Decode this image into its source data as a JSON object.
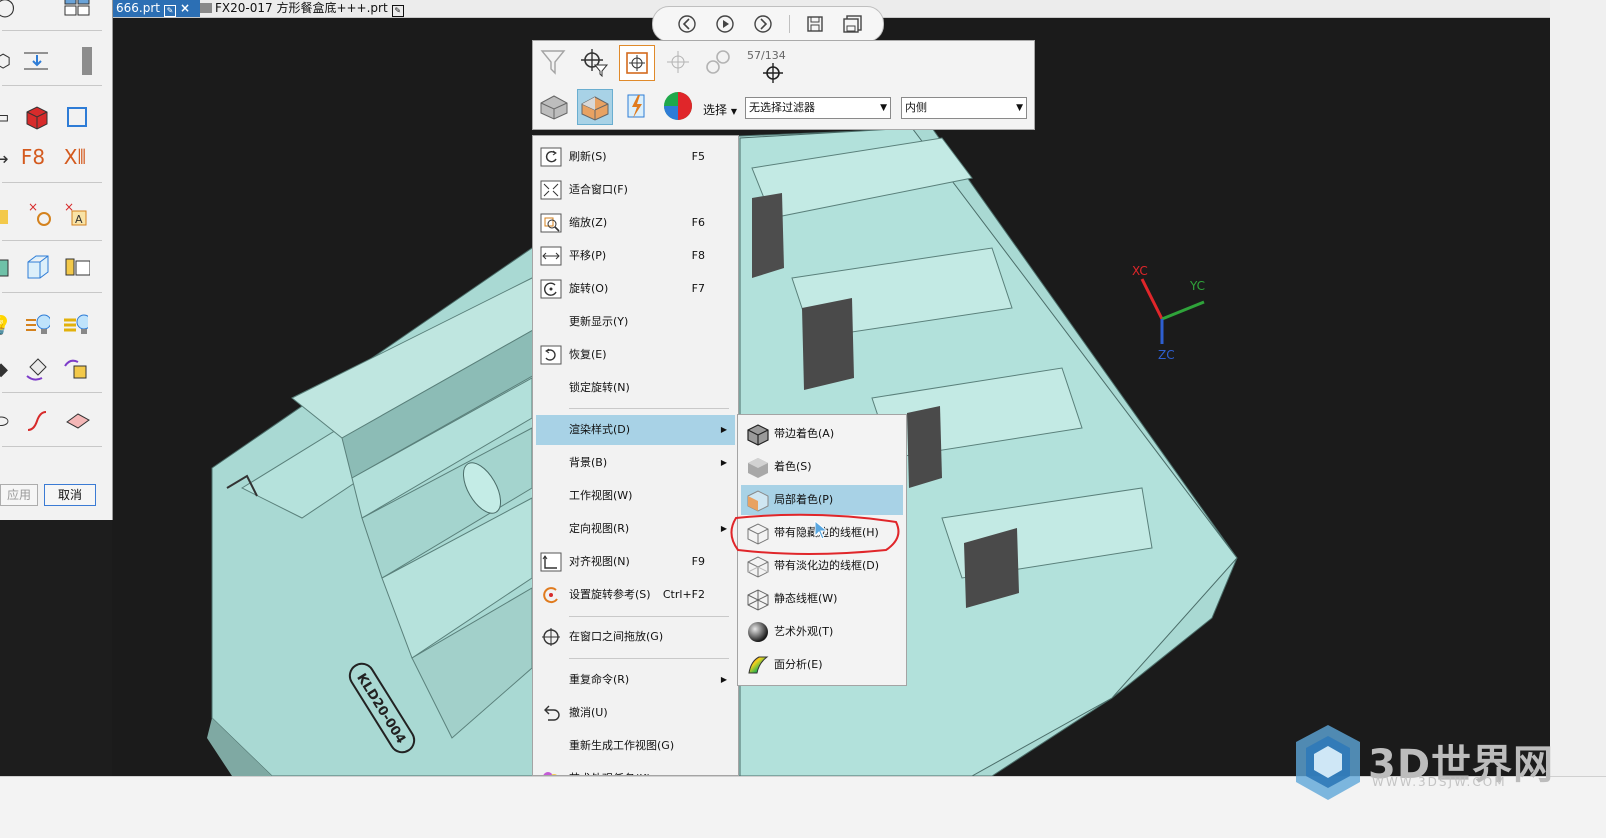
{
  "tabs": [
    {
      "label": "666.prt"
    },
    {
      "label": "FX20-017 方形餐盒底+++.prt"
    }
  ],
  "left_panel": {
    "f8_label": "F8",
    "apply_label": "应用",
    "cancel_label": "取消"
  },
  "selection_toolbar": {
    "counter": "57/134",
    "select_label": "选择",
    "filter_value": "无选择过滤器",
    "scope_value": "内侧"
  },
  "context_menu": {
    "items": [
      {
        "label": "刷新(S)",
        "shortcut": "F5",
        "icon": "refresh-icon"
      },
      {
        "label": "适合窗口(F)",
        "shortcut": "",
        "icon": "fit-window-icon"
      },
      {
        "label": "缩放(Z)",
        "shortcut": "F6",
        "icon": "zoom-icon"
      },
      {
        "label": "平移(P)",
        "shortcut": "F8",
        "icon": "pan-icon"
      },
      {
        "label": "旋转(O)",
        "shortcut": "F7",
        "icon": "rotate-icon"
      },
      {
        "label": "更新显示(Y)",
        "shortcut": "",
        "icon": ""
      },
      {
        "label": "恢复(E)",
        "shortcut": "",
        "icon": "restore-icon"
      },
      {
        "label": "锁定旋转(N)",
        "shortcut": "",
        "icon": ""
      },
      {
        "label": "渲染样式(D)",
        "shortcut": "",
        "icon": ""
      },
      {
        "label": "背景(B)",
        "shortcut": "",
        "icon": ""
      },
      {
        "label": "工作视图(W)",
        "shortcut": "",
        "icon": ""
      },
      {
        "label": "定向视图(R)",
        "shortcut": "",
        "icon": ""
      },
      {
        "label": "对齐视图(N)",
        "shortcut": "F9",
        "icon": "align-view-icon"
      },
      {
        "label": "设置旋转参考(S)",
        "shortcut": "Ctrl+F2",
        "icon": "rotate-reference-icon"
      },
      {
        "label": "在窗口之间拖放(G)",
        "shortcut": "",
        "icon": "drag-between-windows-icon"
      },
      {
        "label": "重复命令(R)",
        "shortcut": "",
        "icon": ""
      },
      {
        "label": "撤消(U)",
        "shortcut": "",
        "icon": "undo-icon"
      },
      {
        "label": "重新生成工作视图(G)",
        "shortcut": "",
        "icon": ""
      },
      {
        "label": "艺术外观任务(K)",
        "shortcut": "",
        "icon": "artistic-appearance-icon"
      }
    ],
    "highlighted": "渲染样式(D)"
  },
  "render_submenu": {
    "items": [
      {
        "label": "带边着色(A)",
        "icon": "shaded-with-edges-icon"
      },
      {
        "label": "着色(S)",
        "icon": "shaded-icon"
      },
      {
        "label": "局部着色(P)",
        "icon": "partial-shading-icon"
      },
      {
        "label": "带有隐藏边的线框(H)",
        "icon": "wireframe-hidden-edges-icon"
      },
      {
        "label": "带有淡化边的线框(D)",
        "icon": "wireframe-dim-edges-icon"
      },
      {
        "label": "静态线框(W)",
        "icon": "static-wireframe-icon"
      },
      {
        "label": "艺术外观(T)",
        "icon": "artistic-appearance-sphere-icon"
      },
      {
        "label": "面分析(E)",
        "icon": "face-analysis-icon"
      }
    ],
    "highlighted": "局部着色(P)",
    "annotated": "带有隐藏边的线框(H)"
  },
  "axes": {
    "xc": "XC",
    "yc": "YC",
    "zc": "ZC"
  },
  "model_label": "KLD20-004",
  "watermark": {
    "text": "3D世界网",
    "url": "WWW.3DSJW.COM"
  },
  "colors": {
    "model": "#a8d8d2",
    "model_shadow": "#6f9f99",
    "highlight": "#a8d2e6",
    "annotation": "#e0262a",
    "tab_active": "#2c6fb4"
  }
}
